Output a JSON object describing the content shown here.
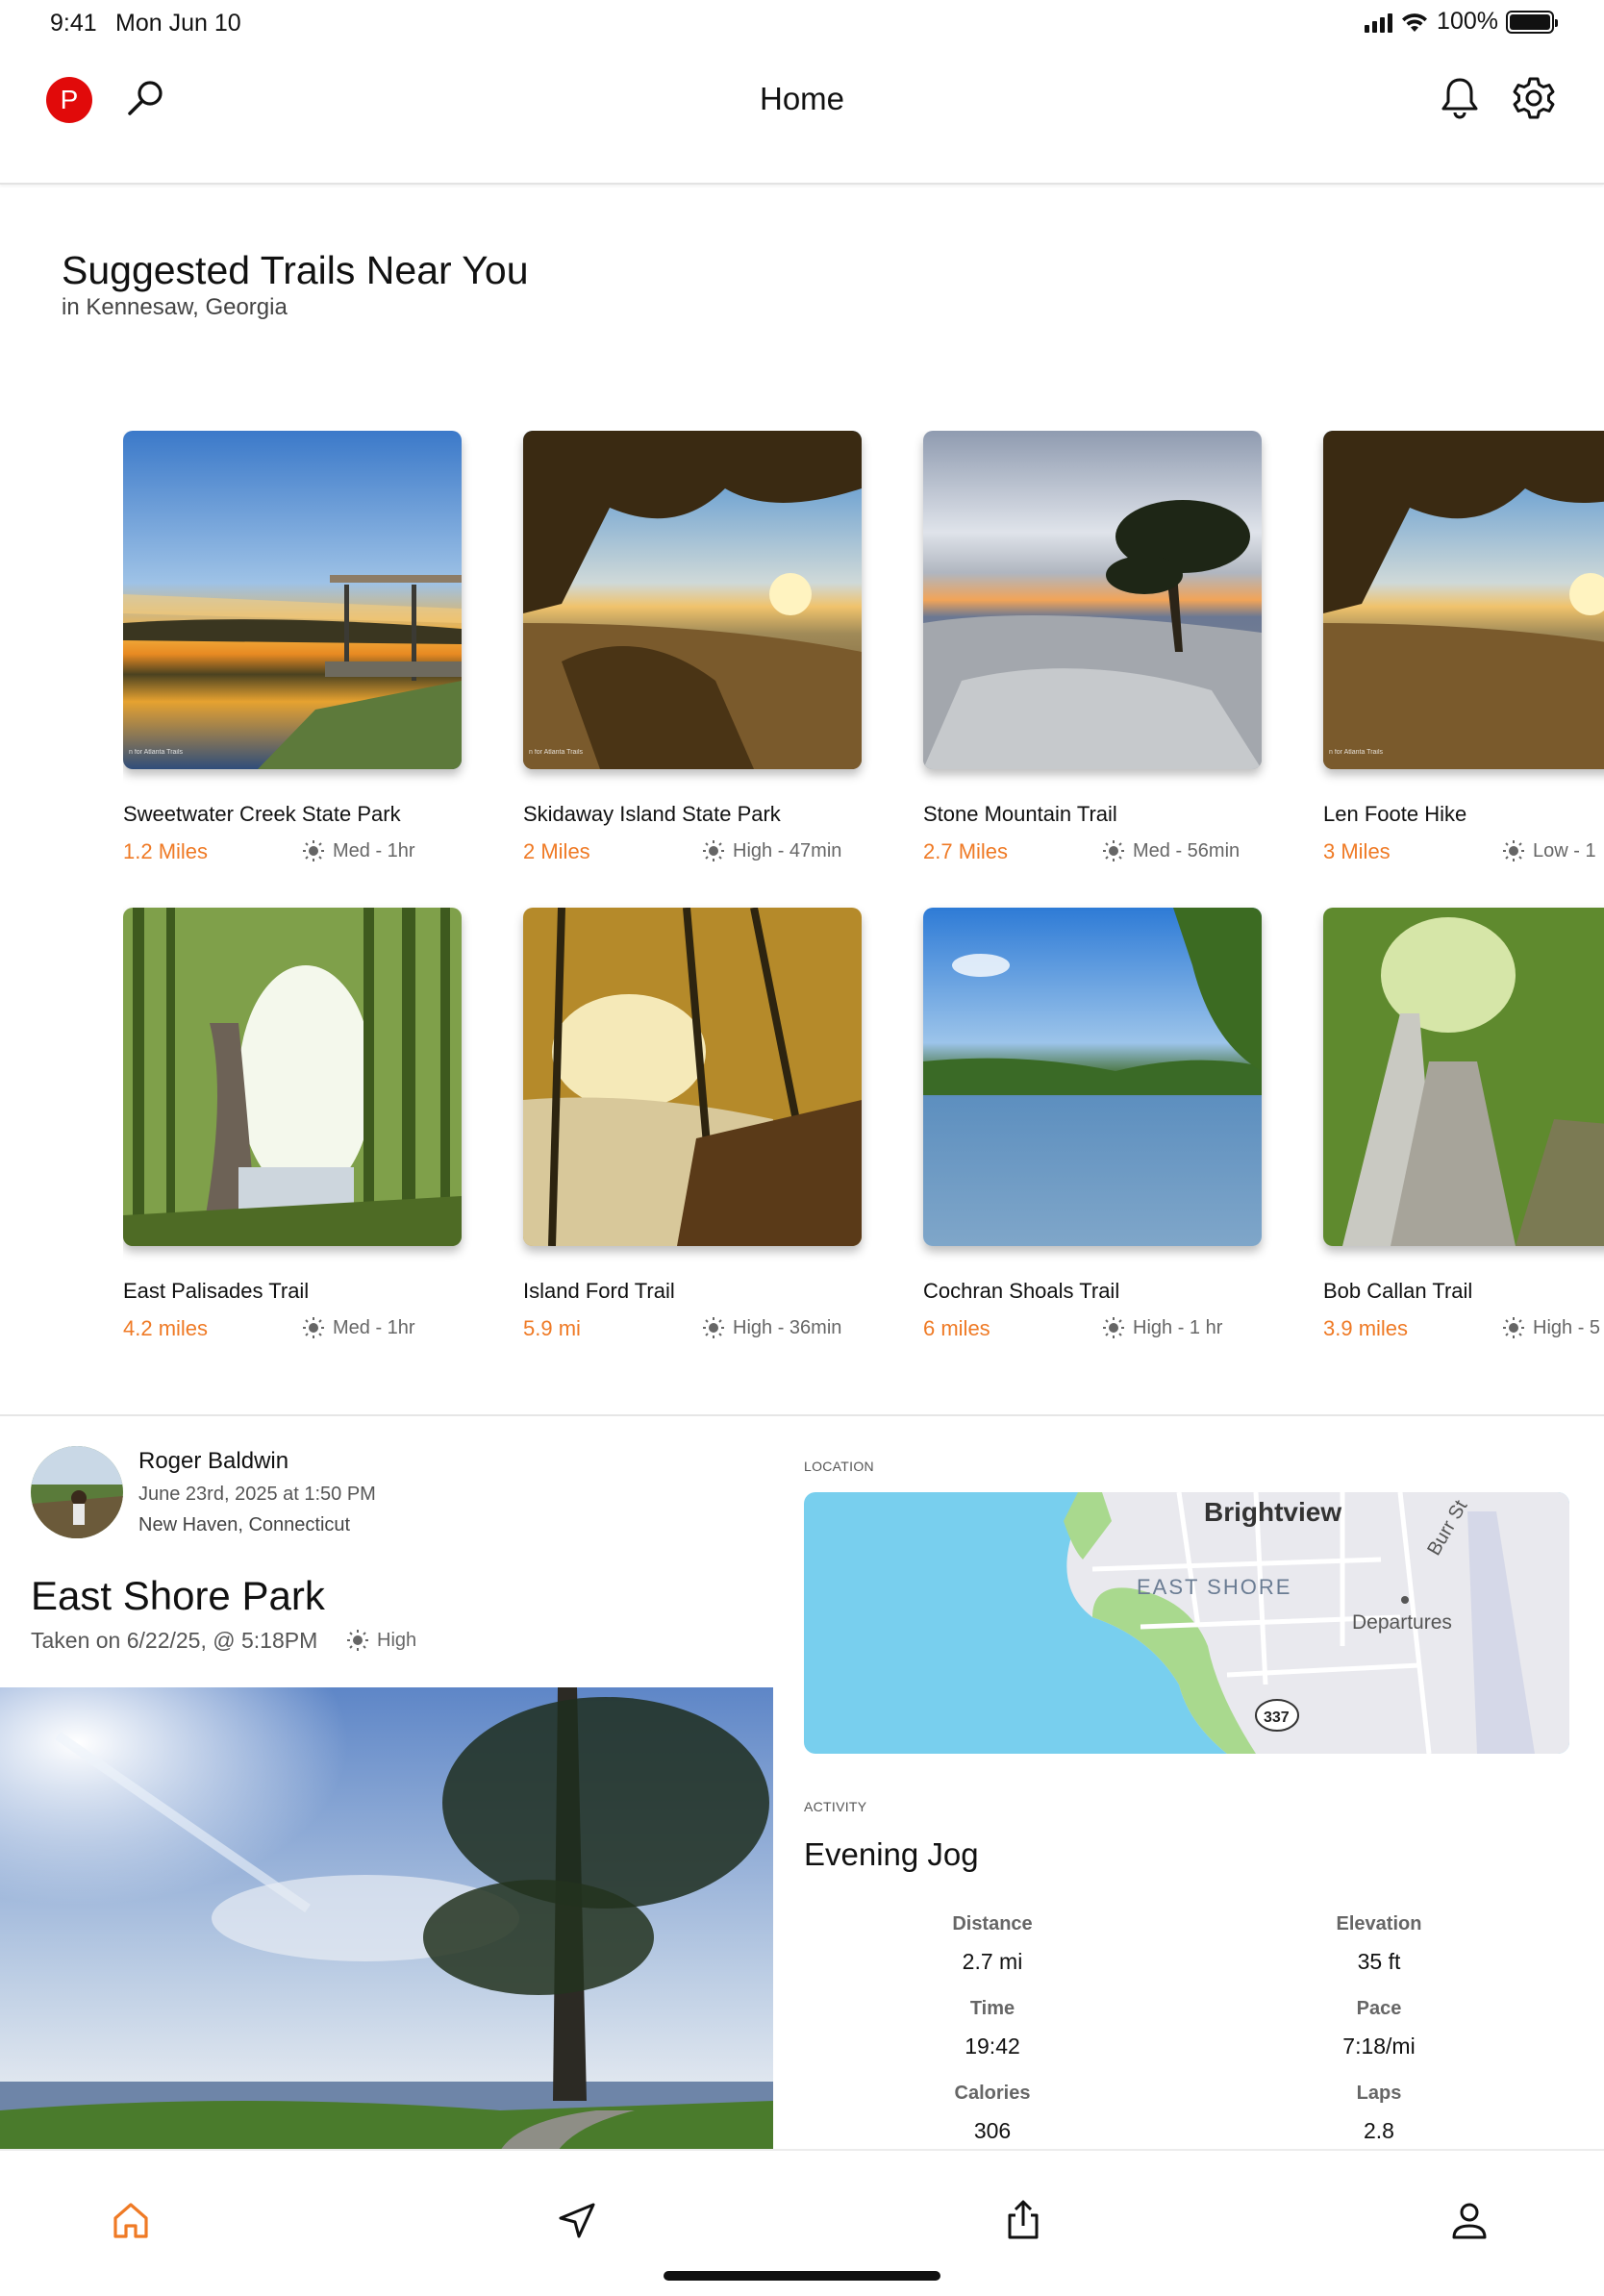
{
  "status_bar": {
    "time": "9:41",
    "date": "Mon Jun 10",
    "battery": "100%"
  },
  "header": {
    "avatar_letter": "P",
    "title": "Home"
  },
  "suggested": {
    "title": "Suggested Trails Near You",
    "subtitle": "in Kennesaw, Georgia",
    "watermark": "n for Atlanta Trails",
    "trails": [
      {
        "name": "Sweetwater Creek State Park",
        "distance": "1.2 Miles",
        "difficulty": "Med - 1hr"
      },
      {
        "name": "Skidaway Island State Park",
        "distance": "2 Miles",
        "difficulty": "High - 47min"
      },
      {
        "name": "Stone Mountain Trail",
        "distance": "2.7 Miles",
        "difficulty": "Med - 56min"
      },
      {
        "name": "Len Foote Hike",
        "distance": "3 Miles",
        "difficulty": "Low - 1"
      },
      {
        "name": "East Palisades Trail",
        "distance": "4.2 miles",
        "difficulty": "Med - 1hr"
      },
      {
        "name": "Island Ford Trail",
        "distance": "5.9 mi",
        "difficulty": "High - 36min"
      },
      {
        "name": "Cochran Shoals Trail",
        "distance": "6 miles",
        "difficulty": "High - 1 hr"
      },
      {
        "name": "Bob Callan Trail",
        "distance": "3.9 miles",
        "difficulty": "High - 5"
      }
    ]
  },
  "post": {
    "user": "Roger Baldwin",
    "date": "June 23rd, 2025 at 1:50 PM",
    "location": "New Haven, Connecticut",
    "title": "East Shore Park",
    "taken": "Taken on 6/22/25, @ 5:18PM",
    "difficulty": "High"
  },
  "location": {
    "label": "LOCATION",
    "map_labels": {
      "neighborhood": "Brightview",
      "area": "EAST SHORE",
      "place": "Departures",
      "road": "Burr St",
      "route": "337"
    }
  },
  "activity": {
    "label": "ACTIVITY",
    "title": "Evening Jog",
    "stats": [
      {
        "label": "Distance",
        "value": "2.7 mi"
      },
      {
        "label": "Elevation",
        "value": "35 ft"
      },
      {
        "label": "Time",
        "value": "19:42"
      },
      {
        "label": "Pace",
        "value": "7:18/mi"
      },
      {
        "label": "Calories",
        "value": "306"
      },
      {
        "label": "Laps",
        "value": "2.8"
      }
    ]
  },
  "tabbar": {
    "active_color": "#ef7a25",
    "tabs": [
      "home-icon",
      "navigate-icon",
      "share-icon",
      "profile-icon"
    ]
  },
  "colors": {
    "accent": "#ef7a25",
    "avatar": "#e10a0a",
    "map_water": "#78cfee",
    "map_land": "#e8e8ec",
    "map_park": "#a9d98e"
  }
}
